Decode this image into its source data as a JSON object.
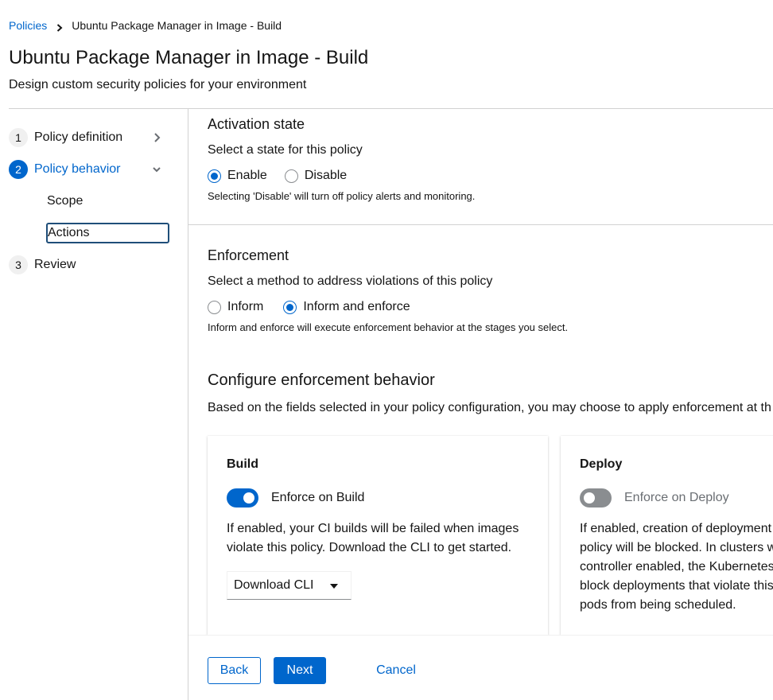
{
  "breadcrumb": {
    "parent": "Policies",
    "current": "Ubuntu Package Manager in Image - Build"
  },
  "page": {
    "title": "Ubuntu Package Manager in Image - Build",
    "description": "Design custom security policies for your environment"
  },
  "wizard_nav": {
    "steps": [
      {
        "number": "1",
        "label": "Policy definition",
        "toggle_icon": "chevron-right-icon"
      },
      {
        "number": "2",
        "label": "Policy behavior",
        "toggle_icon": "chevron-down-icon",
        "substeps": [
          "Scope",
          "Actions"
        ]
      },
      {
        "number": "3",
        "label": "Review"
      }
    ],
    "active_step": "Policy behavior",
    "current_substep": "Actions"
  },
  "activation": {
    "title": "Activation state",
    "subtitle": "Select a state for this policy",
    "options": [
      "Enable",
      "Disable"
    ],
    "selected": "Enable",
    "helper": "Selecting 'Disable' will turn off policy alerts and monitoring."
  },
  "enforcement": {
    "title": "Enforcement",
    "subtitle": "Select a method to address violations of this policy",
    "options": [
      "Inform",
      "Inform and enforce"
    ],
    "selected": "Inform and enforce",
    "helper": "Inform and enforce will execute enforcement behavior at the stages you select."
  },
  "configure": {
    "title": "Configure enforcement behavior",
    "description": "Based on the fields selected in your policy configuration, you may choose to apply enforcement at th"
  },
  "build_card": {
    "title": "Build",
    "toggle_label": "Enforce on Build",
    "toggle_on": true,
    "body_line1": "If enabled, your CI builds will be failed when images",
    "body_line2": "violate this policy. Download the CLI to get started.",
    "dropdown_label": "Download CLI"
  },
  "deploy_card": {
    "title": "Deploy",
    "toggle_label": "Enforce on Deploy",
    "toggle_on": false,
    "body_lines": [
      "If enabled, creation of deployment",
      "policy will be blocked. In clusters w",
      "controller enabled, the Kubernetes",
      "block deployments that violate this",
      "pods from being scheduled."
    ]
  },
  "footer": {
    "back_label": "Back",
    "next_label": "Next",
    "cancel_label": "Cancel"
  },
  "colors": {
    "accent": "#0066cc",
    "border": "#d2d2d2",
    "toggle_off": "#8a8d90"
  }
}
